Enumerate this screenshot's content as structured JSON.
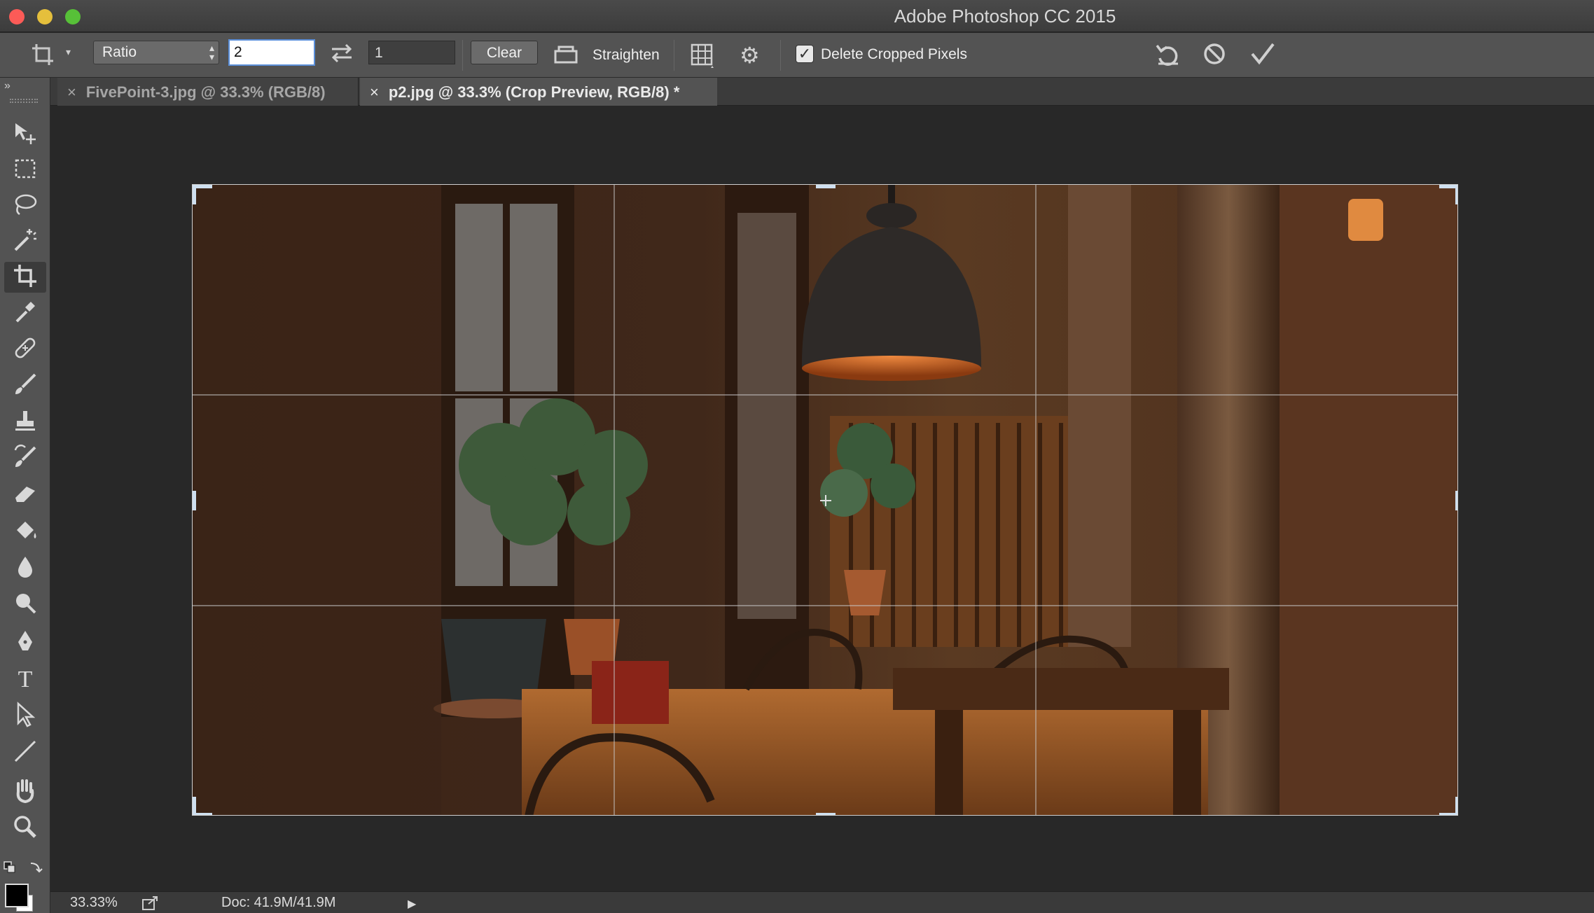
{
  "window": {
    "title": "Adobe Photoshop CC 2015"
  },
  "options_bar": {
    "ratio_select": "Ratio",
    "width_value": "2",
    "height_value": "1",
    "clear_label": "Clear",
    "straighten_label": "Straighten",
    "delete_cropped_label": "Delete Cropped Pixels",
    "delete_cropped_checked": true
  },
  "tabs": [
    {
      "label": "FivePoint-3.jpg @ 33.3% (RGB/8)",
      "active": false
    },
    {
      "label": "p2.jpg @ 33.3% (Crop Preview, RGB/8) *",
      "active": true
    }
  ],
  "tools": [
    "move-tool-icon",
    "marquee-tool-icon",
    "lasso-tool-icon",
    "magic-wand-icon",
    "crop-tool-icon",
    "eyedropper-icon",
    "healing-brush-icon",
    "brush-icon",
    "clone-stamp-icon",
    "history-brush-icon",
    "eraser-icon",
    "paint-bucket-icon",
    "blur-icon",
    "dodge-icon",
    "pen-tool-icon",
    "type-tool-icon",
    "path-selection-icon",
    "line-tool-icon",
    "hand-tool-icon",
    "zoom-tool-icon"
  ],
  "status": {
    "zoom": "33.33%",
    "doc": "Doc: 41.9M/41.9M"
  },
  "colors": {
    "foreground": "#000000",
    "background": "#ffffff",
    "accent": "#5b8fd9"
  }
}
